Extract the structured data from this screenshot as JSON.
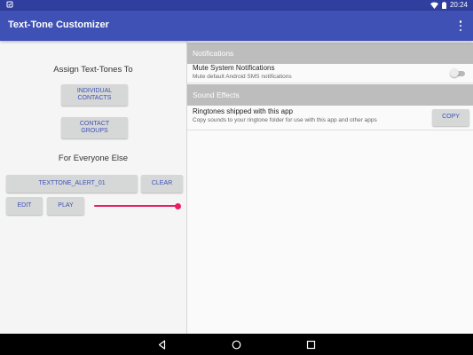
{
  "status_bar": {
    "notification_icon": "notification-icon",
    "wifi_icon": "wifi-icon",
    "battery_icon": "battery-icon",
    "time": "20:24"
  },
  "app_bar": {
    "title": "Text-Tone Customizer",
    "overflow_icon": "overflow-menu-icon"
  },
  "left": {
    "assign_heading": "Assign Text-Tones To",
    "individual_contacts": [
      "INDIVIDUAL",
      "CONTACTS"
    ],
    "contact_groups": [
      "CONTACT",
      "GROUPS"
    ],
    "everyone_heading": "For Everyone Else",
    "tone_button": "TEXTTONE_ALERT_01",
    "clear_button": "CLEAR",
    "edit_button": "EDIT",
    "play_button": "PLAY",
    "volume_level": 1.0
  },
  "right": {
    "notifications_header": "Notifications",
    "mute_title": "Mute System Notifications",
    "mute_summary": "Mute default Android SMS notifications",
    "mute_enabled": false,
    "sound_effects_header": "Sound Effects",
    "ringtones_title": "Ringtones shipped with this app",
    "ringtones_summary": "Copy sounds to your ringtone folder for use with this app and other apps",
    "copy_button": "COPY"
  },
  "nav_bar": {
    "back_icon": "back-icon",
    "home_icon": "home-icon",
    "recents_icon": "recents-icon"
  },
  "colors": {
    "primary": "#3f51b5",
    "primary_dark": "#303f9f",
    "accent": "#e91e63",
    "button_gray": "#d6d7d7",
    "header_gray": "#bdbdbd"
  }
}
